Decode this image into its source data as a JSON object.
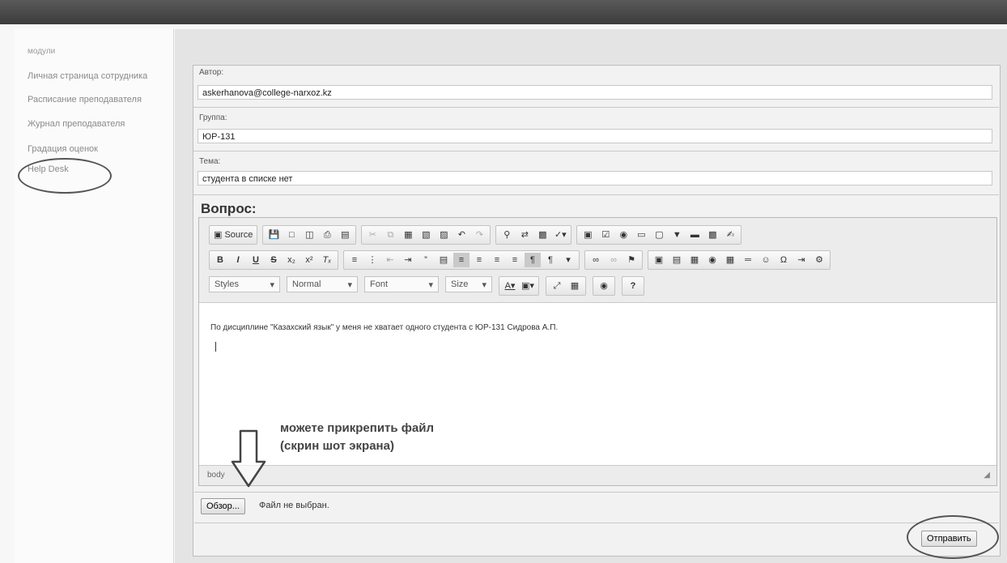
{
  "sidebar": {
    "items": [
      {
        "label": "модули"
      },
      {
        "label": "Личная страница сотрудника"
      },
      {
        "label": "Расписание преподавателя"
      },
      {
        "label": "Журнал преподавателя"
      },
      {
        "label": "Градация оценок"
      },
      {
        "label": "Help Desk"
      }
    ]
  },
  "form": {
    "author": {
      "label": "Автор:",
      "value": "askerhanova@college-narxoz.kz"
    },
    "group": {
      "label": "Группа:",
      "value": "ЮР-131"
    },
    "topic": {
      "label": "Тема:",
      "value": "студента в списке нет"
    },
    "question_label": "Вопрос:"
  },
  "editor": {
    "source_label": "Source",
    "combos": {
      "styles": "Styles",
      "format": "Normal",
      "font": "Font",
      "size": "Size"
    },
    "content_text": "По дисциплине \"Казахский язык\" у меня не хватает одного студента с ЮР-131 Сидрова А.П.",
    "status_path": "body"
  },
  "annotation": {
    "line1": "можете прикрепить файл",
    "line2": "(скрин шот экрана)"
  },
  "attach": {
    "browse_label": "Обзор...",
    "status": "Файл не выбран."
  },
  "submit_label": "Отправить",
  "colors": {
    "topbar": "#4a4a4a",
    "annotation_ring": "#555555"
  }
}
